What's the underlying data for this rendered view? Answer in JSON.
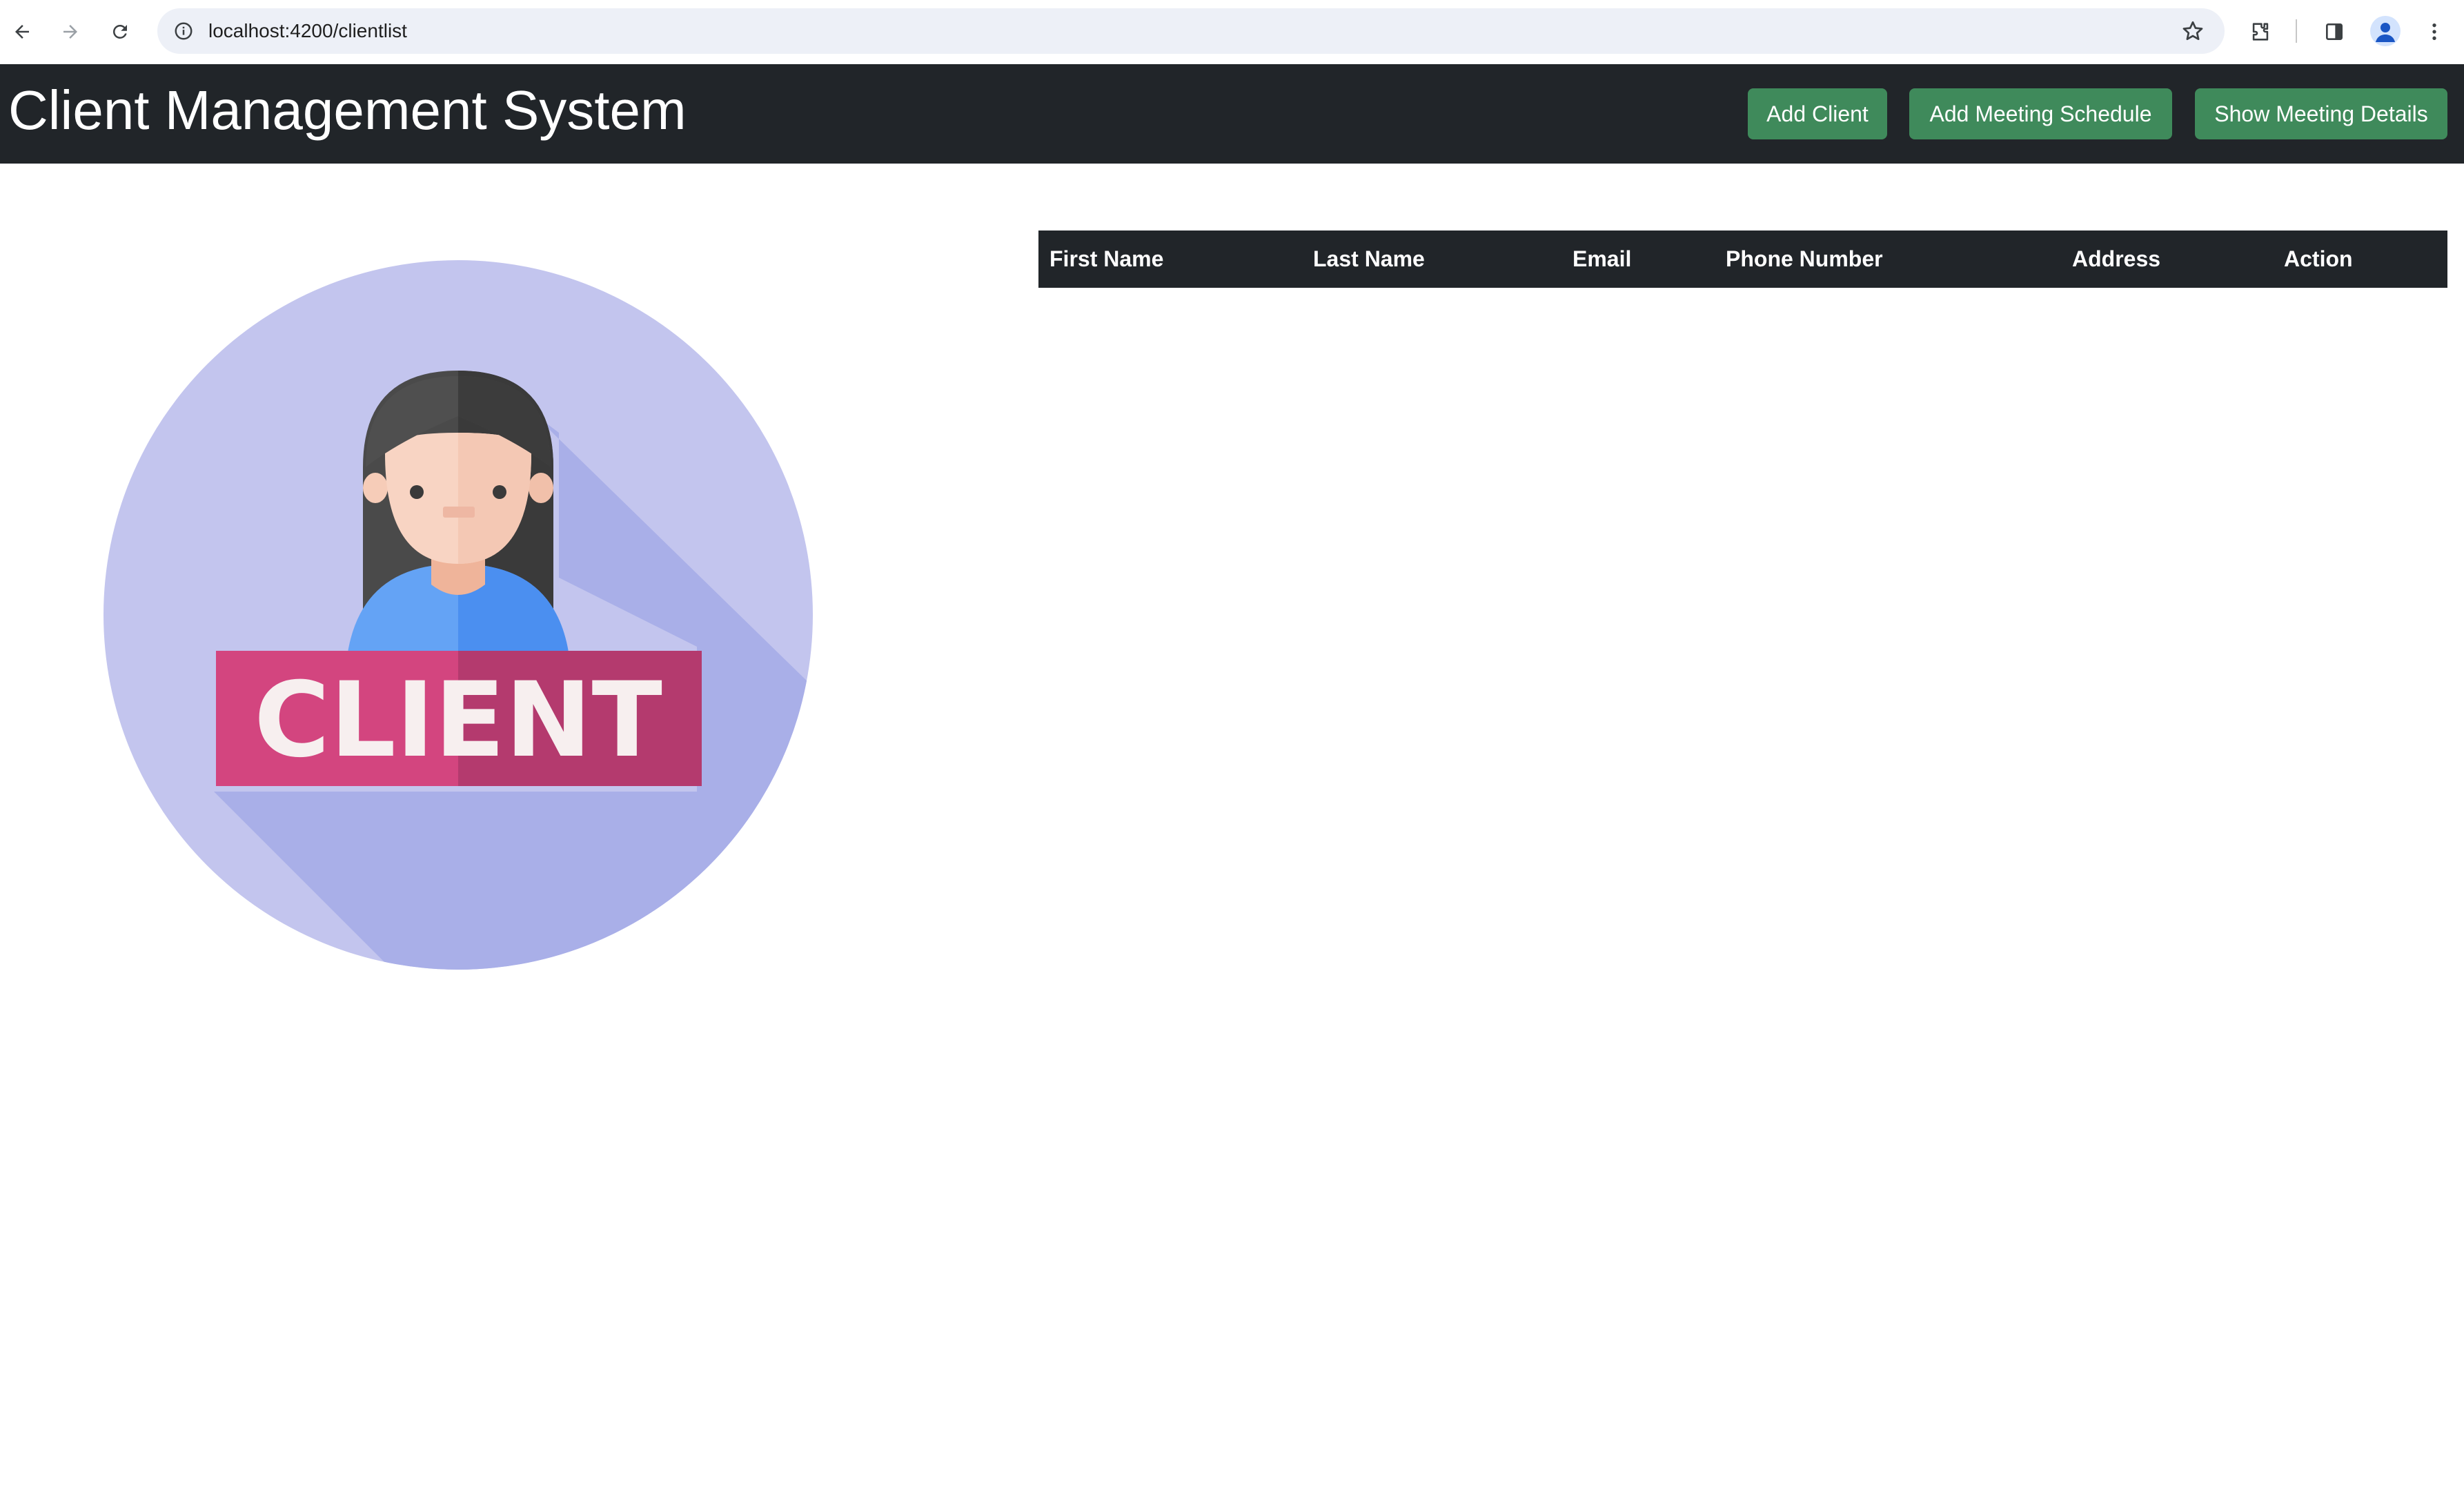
{
  "browser": {
    "url": "localhost:4200/clientlist"
  },
  "navbar": {
    "title": "Client Management System",
    "buttons": [
      {
        "label": "Add Client"
      },
      {
        "label": "Add Meeting Schedule"
      },
      {
        "label": "Show Meeting Details"
      }
    ]
  },
  "client_image": {
    "banner_text": "CLIENT"
  },
  "table": {
    "headers": [
      "First Name",
      "Last Name",
      "Email",
      "Phone Number",
      "Address",
      "Action"
    ],
    "rows": []
  },
  "colors": {
    "navbar_bg": "#212529",
    "button_bg": "#3f8a5b",
    "button_text": "#ffffff",
    "circle_bg": "#c3c5ee",
    "banner_pink": "#d3457f"
  },
  "icons": [
    "back-arrow-icon",
    "forward-arrow-icon",
    "reload-icon",
    "site-info-icon",
    "bookmark-star-icon",
    "extensions-icon",
    "side-panel-icon",
    "profile-avatar-icon",
    "kebab-menu-icon"
  ]
}
